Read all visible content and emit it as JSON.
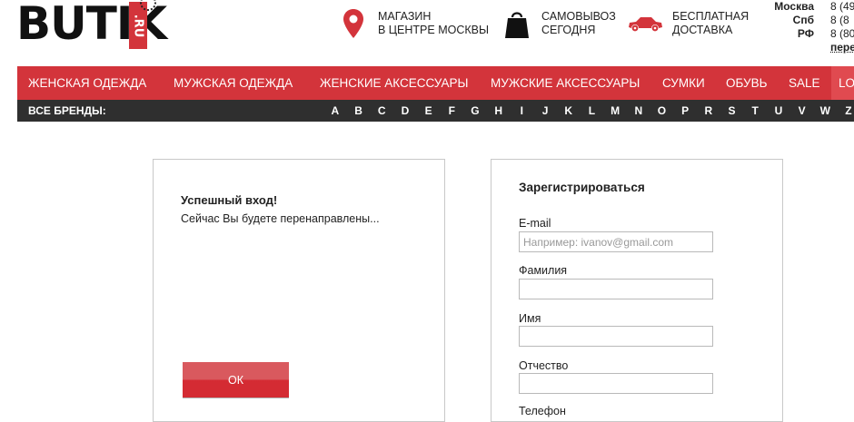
{
  "logo": {
    "text": "BUTIK",
    "tag": ".RU"
  },
  "features": [
    {
      "icon": "map-pin-icon",
      "line1": "МАГАЗИН",
      "line2": "В ЦЕНТРЕ МОСКВЫ"
    },
    {
      "icon": "shopping-bag-icon",
      "line1": "САМОВЫВОЗ",
      "line2": "СЕГОДНЯ"
    },
    {
      "icon": "car-icon",
      "line1": "БЕСПЛАТНАЯ",
      "line2": "ДОСТАВКА"
    }
  ],
  "phones": {
    "rows": [
      {
        "city": "Москва",
        "number": "8 (49"
      },
      {
        "city": "Спб",
        "number": "8 (8"
      },
      {
        "city": "РФ",
        "number": "8 (80"
      }
    ],
    "more": "пере"
  },
  "nav": {
    "items": [
      "ЖЕНСКАЯ ОДЕЖДА",
      "МУЖСКАЯ ОДЕЖДА",
      "ЖЕНСКИЕ АКСЕССУАРЫ",
      "МУЖСКИЕ АКСЕССУАРЫ",
      "СУМКИ",
      "ОБУВЬ",
      "SALE"
    ],
    "login": "LO"
  },
  "brands": {
    "label": "ВСЕ БРЕНДЫ:",
    "letters": [
      "A",
      "B",
      "C",
      "D",
      "E",
      "F",
      "G",
      "H",
      "I",
      "J",
      "K",
      "L",
      "M",
      "N",
      "O",
      "P",
      "R",
      "S",
      "T",
      "U",
      "V",
      "W",
      "Z"
    ]
  },
  "login_result": {
    "title": "Успешный вход!",
    "message": "Сейчас Вы будете перенаправлены...",
    "ok_label": "ОК"
  },
  "register": {
    "title": "Зарегистрироваться",
    "fields": [
      {
        "label": "E-mail",
        "value": "",
        "placeholder": "Например: ivanov@gmail.com"
      },
      {
        "label": "Фамилия",
        "value": "",
        "placeholder": ""
      },
      {
        "label": "Имя",
        "value": "",
        "placeholder": ""
      },
      {
        "label": "Отчество",
        "value": "",
        "placeholder": ""
      },
      {
        "label": "Телефон",
        "value": "",
        "placeholder": ""
      }
    ]
  },
  "colors": {
    "brand_red": "#d3343b",
    "brand_bar": "#2f2f2f"
  }
}
